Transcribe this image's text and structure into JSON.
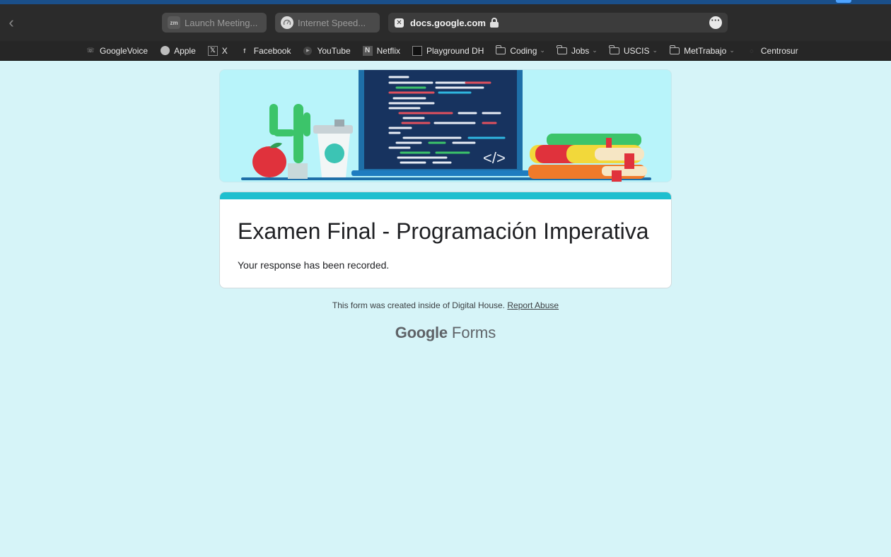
{
  "browser": {
    "back_label": "‹",
    "tabs": [
      {
        "label": "Launch Meeting...",
        "icon": "zoom-icon",
        "icon_text": "zm"
      },
      {
        "label": "Internet Speed...",
        "icon": "speedometer-icon"
      }
    ],
    "address": {
      "url": "docs.google.com",
      "site_icon_text": "✕",
      "more_label": "···"
    }
  },
  "bookmarks": [
    {
      "label": "GoogleVoice",
      "icon": "phone-icon"
    },
    {
      "label": "Apple",
      "icon": "apple-icon"
    },
    {
      "label": "X",
      "icon": "x-logo-icon"
    },
    {
      "label": "Facebook",
      "icon": "facebook-icon"
    },
    {
      "label": "YouTube",
      "icon": "youtube-icon"
    },
    {
      "label": "Netflix",
      "icon": "netflix-icon"
    },
    {
      "label": "Playground DH",
      "icon": "terminal-icon"
    },
    {
      "label": "Coding",
      "icon": "folder-icon"
    },
    {
      "label": "Jobs",
      "icon": "folder-icon"
    },
    {
      "label": "USCIS",
      "icon": "folder-icon"
    },
    {
      "label": "MetTrabajo",
      "icon": "folder-icon"
    },
    {
      "label": "Centrosur",
      "icon": "globe-icon"
    }
  ],
  "form": {
    "title": "Examen Final - Programación Imperativa",
    "confirmation": "Your response has been recorded.",
    "footer_text": "This form was created inside of Digital House.",
    "report_link": "Report Abuse",
    "brand_google": "Google",
    "brand_forms": "Forms",
    "banner_code_tag": "</>"
  },
  "colors": {
    "page_bg": "#d6f4f8",
    "banner_bg": "#b8f4fa",
    "accent": "#1fbfcf",
    "toolbar": "#2b2b2b"
  }
}
